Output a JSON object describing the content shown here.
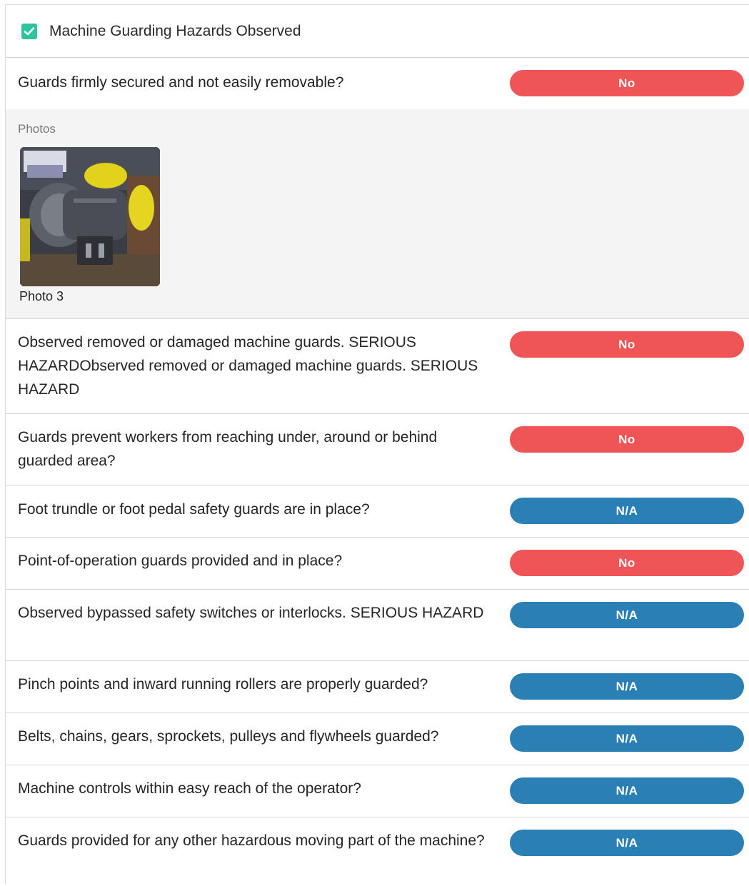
{
  "section": {
    "title": "Machine Guarding Hazards Observed",
    "checked": true,
    "check_color": "#2ec4a0"
  },
  "colors": {
    "no": "#ef5456",
    "na": "#2a7fb4"
  },
  "items": [
    {
      "question": "Guards firmly secured and not easily removable?",
      "answer": "No",
      "photos_label": "Photos",
      "photo_caption": "Photo 3"
    },
    {
      "question": "Observed removed or damaged machine guards. SERIOUS HAZARDObserved removed or damaged machine guards. SERIOUS HAZARD",
      "answer": "No"
    },
    {
      "question": "Guards prevent workers from reaching under, around or behind guarded area?",
      "answer": "No"
    },
    {
      "question": "Foot trundle or foot pedal safety guards are in place?",
      "answer": "N/A"
    },
    {
      "question": "Point-of-operation guards provided and in place?",
      "answer": "No"
    },
    {
      "question": "Observed bypassed safety switches or interlocks. SERIOUS HAZARD",
      "answer": "N/A"
    },
    {
      "question": "Pinch points and inward running rollers are properly guarded?",
      "answer": "N/A"
    },
    {
      "question": "Belts, chains, gears, sprockets, pulleys and flywheels guarded?",
      "answer": "N/A"
    },
    {
      "question": "Machine controls within easy reach of the operator?",
      "answer": "N/A"
    },
    {
      "question": "Guards provided for any other hazardous moving part of the machine?",
      "answer": "N/A"
    }
  ]
}
